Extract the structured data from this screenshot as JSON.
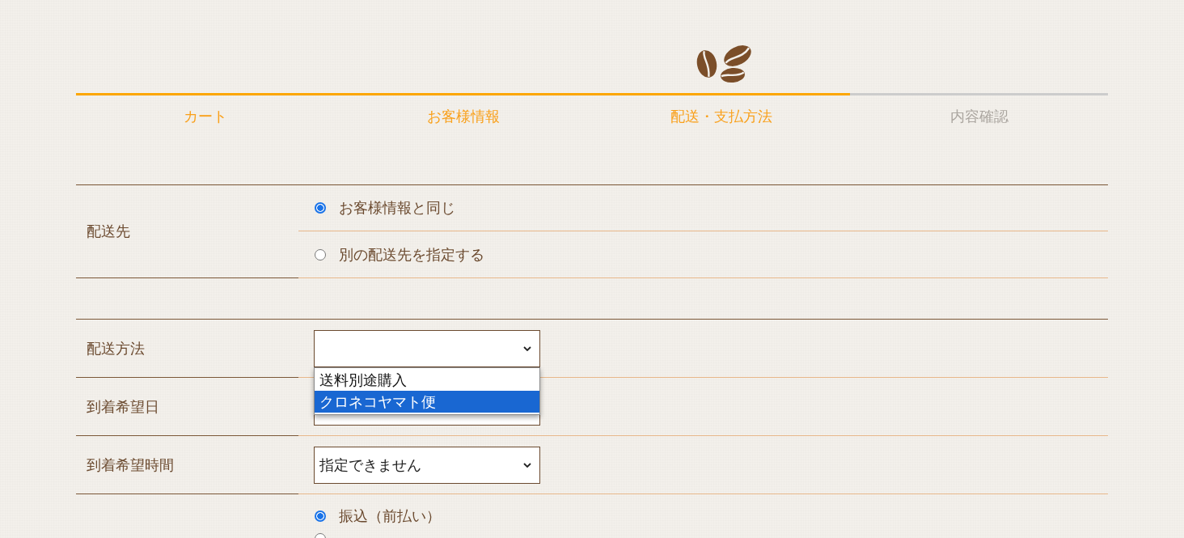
{
  "steps": [
    {
      "label": "カート",
      "done": true
    },
    {
      "label": "お客様情報",
      "done": true
    },
    {
      "label": "配送・支払方法",
      "done": true
    },
    {
      "label": "内容確認",
      "done": false
    }
  ],
  "shipping_to": {
    "label": "配送先",
    "options": [
      {
        "label": "お客様情報と同じ",
        "selected": true
      },
      {
        "label": "別の配送先を指定する",
        "selected": false
      }
    ]
  },
  "fields": [
    {
      "kind": "select",
      "label": "配送方法",
      "options": [
        {
          "label": "送料別途購入",
          "selected": false
        },
        {
          "label": "クロネコヤマト便",
          "selected": true
        }
      ]
    },
    {
      "kind": "select",
      "label": "到着希望日"
    },
    {
      "kind": "select",
      "label": "到着希望時間",
      "value": "指定できません"
    },
    {
      "kind": "radio",
      "options": [
        {
          "label": "振込（前払い）",
          "selected": true
        },
        {
          "selected": false
        }
      ]
    }
  ]
}
